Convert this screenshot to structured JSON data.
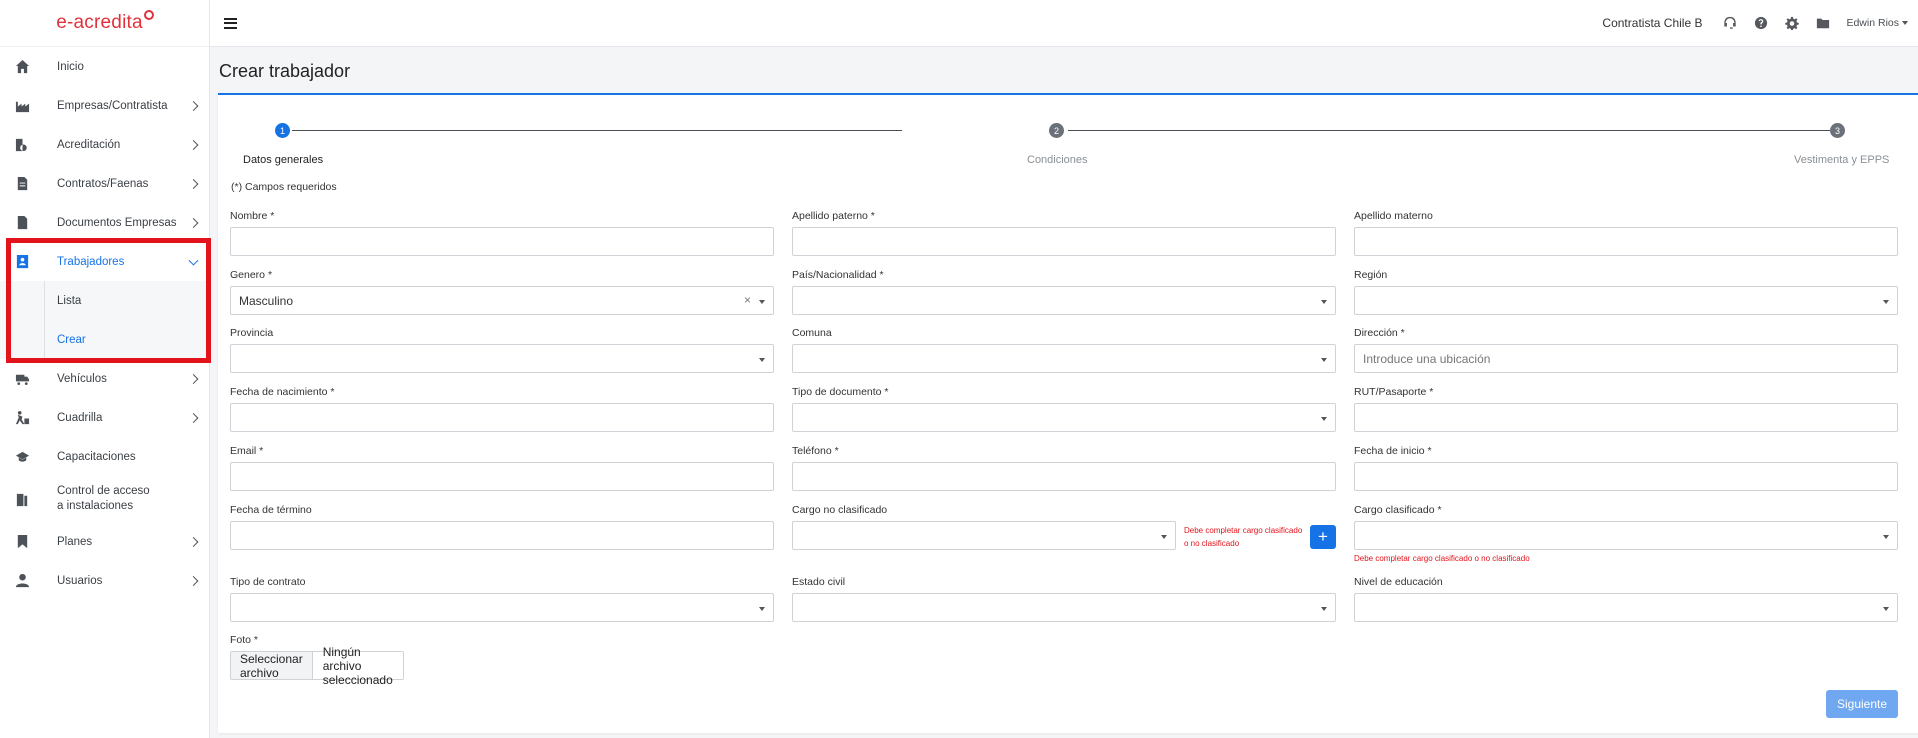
{
  "logo": {
    "text": "e-acredita"
  },
  "sidebar": {
    "items": [
      {
        "label": "Inicio",
        "icon": "home-icon"
      },
      {
        "label": "Empresas/Contratista",
        "icon": "factory-icon"
      },
      {
        "label": "Acreditación",
        "icon": "accreditation-icon"
      },
      {
        "label": "Contratos/Faenas",
        "icon": "contract-icon"
      },
      {
        "label": "Documentos Empresas",
        "icon": "document-icon"
      },
      {
        "label": "Trabajadores",
        "icon": "worker-badge-icon"
      },
      {
        "label": "Vehículos",
        "icon": "truck-icon"
      },
      {
        "label": "Cuadrilla",
        "icon": "crew-icon"
      },
      {
        "label": "Capacitaciones",
        "icon": "graduation-cap-icon"
      },
      {
        "label_line1": "Control de acceso",
        "label_line2": "a instalaciones",
        "icon": "door-icon"
      },
      {
        "label": "Planes",
        "icon": "bookmark-icon"
      },
      {
        "label": "Usuarios",
        "icon": "user-icon"
      }
    ],
    "subitems": [
      {
        "label": "Lista"
      },
      {
        "label": "Crear"
      }
    ]
  },
  "topbar": {
    "company": "Contratista Chile B",
    "user": "Edwin Rios"
  },
  "page": {
    "title": "Crear trabajador"
  },
  "stepper": {
    "steps": [
      {
        "number": "1",
        "label": "Datos generales"
      },
      {
        "number": "2",
        "label": "Condiciones"
      },
      {
        "number": "3",
        "label": "Vestimenta y EPPS"
      }
    ]
  },
  "form": {
    "required_note": "(*) Campos requeridos",
    "nombre": "Nombre *",
    "apellido_paterno": "Apellido paterno *",
    "apellido_materno": "Apellido materno",
    "genero": "Genero *",
    "genero_value": "Masculino",
    "pais": "País/Nacionalidad *",
    "region": "Región",
    "provincia": "Provincia",
    "comuna": "Comuna",
    "direccion": "Dirección *",
    "direccion_placeholder": "Introduce una ubicación",
    "fecha_nacimiento": "Fecha de nacimiento *",
    "tipo_documento": "Tipo de documento *",
    "rut": "RUT/Pasaporte *",
    "email": "Email *",
    "telefono": "Teléfono *",
    "fecha_inicio": "Fecha de inicio *",
    "fecha_termino": "Fecha de término",
    "cargo_no_clasificado": "Cargo no clasificado",
    "cargo_error_line1": "Debe completar cargo clasificado",
    "cargo_error_line2": "o no clasificado",
    "cargo_clasificado": "Cargo clasificado *",
    "cargo_clasificado_error": "Debe completar cargo clasificado o no clasificado",
    "tipo_contrato": "Tipo de contrato",
    "estado_civil": "Estado civil",
    "nivel_educacion": "Nivel de educación",
    "foto": "Foto *",
    "file_button": "Seleccionar archivo",
    "file_status": "Ningún archivo seleccionado",
    "next_button": "Siguiente"
  },
  "colors": {
    "accent": "#1673e6",
    "brand": "#e0323c",
    "error": "#e3131b",
    "highlight": "#e3131b"
  }
}
